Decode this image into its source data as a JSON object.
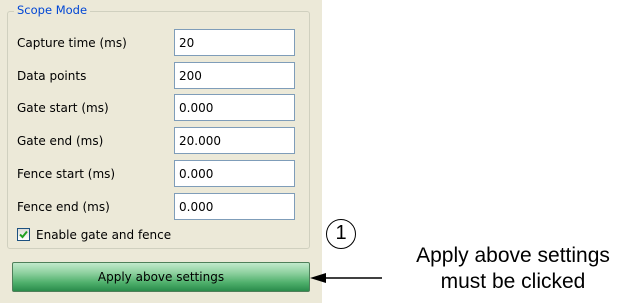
{
  "scope_mode": {
    "legend": "Scope Mode",
    "fields": [
      {
        "label": "Capture time (ms)",
        "value": "20"
      },
      {
        "label": "Data points",
        "value": "200"
      },
      {
        "label": "Gate start (ms)",
        "value": "0.000"
      },
      {
        "label": "Gate end (ms)",
        "value": "20.000"
      },
      {
        "label": "Fence start (ms)",
        "value": "0.000"
      },
      {
        "label": "Fence end (ms)",
        "value": "0.000"
      }
    ],
    "enable_gate_fence": {
      "label": "Enable gate and fence",
      "checked": true
    }
  },
  "apply_button": {
    "label": "Apply above settings"
  },
  "annotation": {
    "callout_number": "1",
    "note_line1": "Apply above settings",
    "note_line2": "must be clicked"
  },
  "colors": {
    "panel_bg": "#ece9d8",
    "legend_text": "#0046d5",
    "input_border": "#7f9db9",
    "button_green": "#4fb06c",
    "checkmark": "#21a121"
  }
}
